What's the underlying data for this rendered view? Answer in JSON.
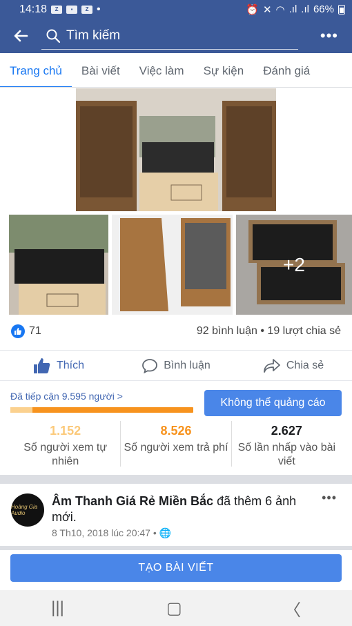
{
  "status_bar": {
    "time": "14:18",
    "icons": [
      "zalo-icon",
      "image-icon",
      "zalo-icon"
    ],
    "battery": "66%"
  },
  "search": {
    "placeholder": "Tìm kiếm"
  },
  "tabs": [
    {
      "label": "Trang chủ"
    },
    {
      "label": "Bài viết"
    },
    {
      "label": "Việc làm"
    },
    {
      "label": "Sự kiện"
    },
    {
      "label": "Đánh giá"
    }
  ],
  "photos": {
    "more_count": "+2"
  },
  "stats": {
    "likes": "71",
    "comments_shares": "92 bình luận • 19 lượt chia sẻ"
  },
  "actions": {
    "like": "Thích",
    "comment": "Bình luận",
    "share": "Chia sẻ"
  },
  "reach": {
    "label": "Đã tiếp cận 9.595 người",
    "fill_fraction": 0.12,
    "boost": "Không thể quảng cáo"
  },
  "metrics": [
    {
      "value": "1.152",
      "label": "Số người xem tự nhiên",
      "color": "#fbc97a"
    },
    {
      "value": "8.526",
      "label": "Số người xem trả phí",
      "color": "#f7931e"
    },
    {
      "value": "2.627",
      "label": "Số lần nhấp vào bài viết",
      "color": "#1c1e21"
    }
  ],
  "post": {
    "author": "Âm Thanh Giá Rẻ Miền Bắc",
    "action": "đã thêm 6 ảnh mới.",
    "time": "8 Th10, 2018 lúc 20:47 •",
    "avatar_text": "Hoàng Gia Audio"
  },
  "create_post": "TẠO BÀI VIẾT",
  "colors": {
    "header": "#3b5998",
    "accent": "#1877f2",
    "button": "#4a86e8"
  }
}
